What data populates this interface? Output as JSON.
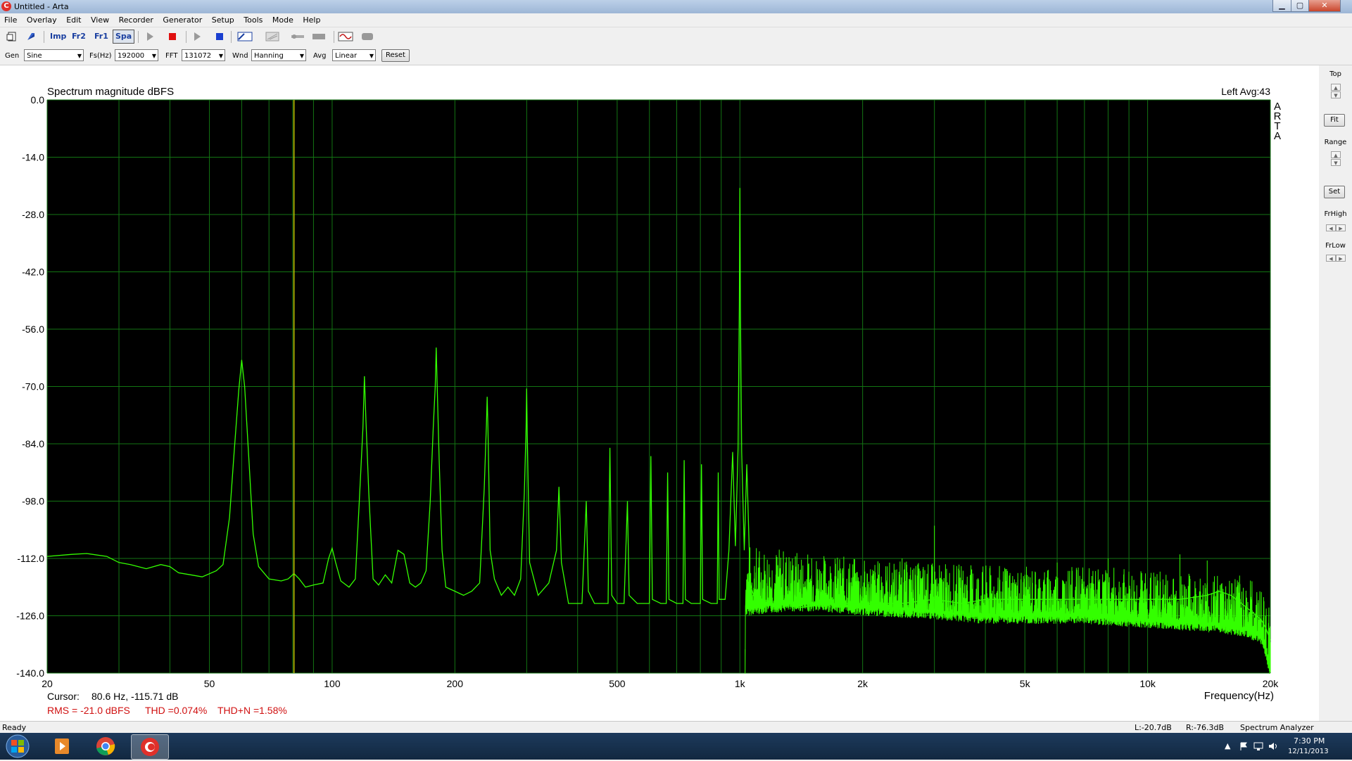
{
  "window": {
    "title": "Untitled - Arta",
    "minimize": "▁",
    "maximize": "▢",
    "close": "✕"
  },
  "menu": [
    "File",
    "Overlay",
    "Edit",
    "View",
    "Recorder",
    "Generator",
    "Setup",
    "Tools",
    "Mode",
    "Help"
  ],
  "toolbar": {
    "imp": "Imp",
    "fr2": "Fr2",
    "fr1": "Fr1",
    "spa": "Spa"
  },
  "options": {
    "gen_label": "Gen",
    "gen_value": "Sine",
    "fs_label": "Fs(Hz)",
    "fs_value": "192000",
    "fft_label": "FFT",
    "fft_value": "131072",
    "wnd_label": "Wnd",
    "wnd_value": "Hanning",
    "avg_label": "Avg",
    "avg_value": "Linear",
    "reset_label": "Reset"
  },
  "right_panel": {
    "top_label": "Top",
    "fit_label": "Fit",
    "range_label": "Range",
    "set_label": "Set",
    "frhigh_label": "FrHigh",
    "frlow_label": "FrLow"
  },
  "chart_data": {
    "type": "line",
    "title": "Spectrum magnitude dBFS",
    "channel_info": "Left  Avg:43",
    "brand": "ARTA",
    "xlabel": "Frequency(Hz)",
    "ylabel": "",
    "x_scale": "log",
    "xlim": [
      20,
      20000
    ],
    "ylim": [
      -140,
      0
    ],
    "x_ticks": [
      20,
      50,
      100,
      200,
      500,
      1000,
      2000,
      5000,
      10000,
      20000
    ],
    "x_tick_labels": [
      "20",
      "50",
      "100",
      "200",
      "500",
      "1k",
      "2k",
      "5k",
      "10k",
      "20k"
    ],
    "y_ticks": [
      0,
      -14,
      -28,
      -42,
      -56,
      -70,
      -84,
      -98,
      -112,
      -126,
      -140
    ],
    "y_tick_labels": [
      "0.0",
      "-14.0",
      "-28.0",
      "-42.0",
      "-56.0",
      "-70.0",
      "-84.0",
      "-98.0",
      "-112.0",
      "-126.0",
      "-140.0"
    ],
    "grid": true,
    "background": "#000000",
    "grid_color": "#137513",
    "line_color": "#33ff00",
    "cursor_color": "#c8c800",
    "cursor_x": 80.6,
    "series": [
      {
        "points": [
          [
            20,
            -111.5
          ],
          [
            23,
            -111
          ],
          [
            25,
            -110.8
          ],
          [
            28,
            -111.5
          ],
          [
            30,
            -113
          ],
          [
            32,
            -113.5
          ],
          [
            35,
            -114.5
          ],
          [
            38,
            -113.5
          ],
          [
            40,
            -114
          ],
          [
            42,
            -115.5
          ],
          [
            45,
            -116
          ],
          [
            48,
            -116.5
          ],
          [
            52,
            -115
          ],
          [
            54,
            -113.5
          ],
          [
            56,
            -102
          ],
          [
            57.5,
            -86
          ],
          [
            59,
            -71
          ],
          [
            60,
            -63.5
          ],
          [
            61,
            -70
          ],
          [
            62.5,
            -88
          ],
          [
            64,
            -106
          ],
          [
            66,
            -114
          ],
          [
            70,
            -117
          ],
          [
            75,
            -117.5
          ],
          [
            78,
            -117
          ],
          [
            80.6,
            -115.7
          ],
          [
            83,
            -117
          ],
          [
            86,
            -119
          ],
          [
            90,
            -118.5
          ],
          [
            95,
            -118
          ],
          [
            98,
            -112
          ],
          [
            100,
            -109.5
          ],
          [
            102,
            -113
          ],
          [
            105,
            -117.5
          ],
          [
            110,
            -119
          ],
          [
            114,
            -117
          ],
          [
            117,
            -95
          ],
          [
            119,
            -80
          ],
          [
            120,
            -67.5
          ],
          [
            121,
            -78
          ],
          [
            123,
            -96
          ],
          [
            126,
            -117
          ],
          [
            130,
            -118.5
          ],
          [
            135,
            -116
          ],
          [
            140,
            -118
          ],
          [
            145,
            -110
          ],
          [
            150,
            -111
          ],
          [
            155,
            -118
          ],
          [
            160,
            -119
          ],
          [
            165,
            -118
          ],
          [
            170,
            -115
          ],
          [
            174,
            -98
          ],
          [
            177,
            -80
          ],
          [
            179,
            -70
          ],
          [
            180,
            -60.5
          ],
          [
            181,
            -70
          ],
          [
            183,
            -88
          ],
          [
            186,
            -110
          ],
          [
            190,
            -119
          ],
          [
            200,
            -120
          ],
          [
            210,
            -121
          ],
          [
            220,
            -120
          ],
          [
            230,
            -118
          ],
          [
            236,
            -95
          ],
          [
            239,
            -79
          ],
          [
            240,
            -72.5
          ],
          [
            241,
            -80
          ],
          [
            244,
            -110
          ],
          [
            250,
            -117
          ],
          [
            260,
            -121
          ],
          [
            270,
            -119
          ],
          [
            280,
            -121
          ],
          [
            290,
            -117
          ],
          [
            296,
            -96
          ],
          [
            299,
            -80
          ],
          [
            300,
            -70.5
          ],
          [
            301,
            -82
          ],
          [
            305,
            -113
          ],
          [
            320,
            -121
          ],
          [
            340,
            -118
          ],
          [
            355,
            -110
          ],
          [
            360,
            -94.5
          ],
          [
            365,
            -113
          ],
          [
            380,
            -123
          ],
          [
            410,
            -123
          ],
          [
            420,
            -98
          ],
          [
            425,
            -120
          ],
          [
            440,
            -123
          ],
          [
            475,
            -123
          ],
          [
            480,
            -85
          ],
          [
            485,
            -121
          ],
          [
            500,
            -123
          ],
          [
            520,
            -123
          ],
          [
            530,
            -98
          ],
          [
            535,
            -121
          ],
          [
            560,
            -123
          ],
          [
            600,
            -123
          ],
          [
            605,
            -87
          ],
          [
            610,
            -122
          ],
          [
            640,
            -123
          ],
          [
            660,
            -123
          ],
          [
            665,
            -91
          ],
          [
            670,
            -122
          ],
          [
            700,
            -123
          ],
          [
            725,
            -123
          ],
          [
            730,
            -88
          ],
          [
            735,
            -122
          ],
          [
            760,
            -123
          ],
          [
            800,
            -123
          ],
          [
            805,
            -89
          ],
          [
            810,
            -122
          ],
          [
            850,
            -123
          ],
          [
            880,
            -123
          ],
          [
            885,
            -91
          ],
          [
            890,
            -122
          ],
          [
            920,
            -122
          ],
          [
            940,
            -110
          ],
          [
            960,
            -86
          ],
          [
            975,
            -109
          ],
          [
            990,
            -85
          ],
          [
            997,
            -50
          ],
          [
            1000,
            -21.5
          ],
          [
            1003,
            -50
          ],
          [
            1010,
            -86
          ],
          [
            1025,
            -110
          ],
          [
            1040,
            -89
          ],
          [
            1060,
            -118
          ],
          [
            1100,
            -124
          ],
          [
            1200,
            -123
          ],
          [
            1400,
            -124
          ],
          [
            1700,
            -123
          ],
          [
            2000,
            -123
          ],
          [
            2500,
            -123
          ],
          [
            3000,
            -122
          ],
          [
            3500,
            -123
          ],
          [
            4000,
            -122
          ],
          [
            5000,
            -122
          ],
          [
            6000,
            -122
          ],
          [
            8000,
            -122
          ],
          [
            10000,
            -122
          ],
          [
            12000,
            -122
          ],
          [
            14000,
            -121
          ],
          [
            15000,
            -120
          ],
          [
            16000,
            -121
          ],
          [
            17000,
            -123
          ],
          [
            18000,
            -125
          ],
          [
            19000,
            -127
          ],
          [
            19500,
            -129
          ],
          [
            20000,
            -132
          ]
        ],
        "noise_floor": [
          [
            1030,
            -124
          ],
          [
            1300,
            -123
          ],
          [
            1600,
            -123
          ],
          [
            2000,
            -124
          ],
          [
            3000,
            -125
          ],
          [
            4000,
            -126
          ],
          [
            5000,
            -126
          ],
          [
            7000,
            -126
          ],
          [
            10000,
            -127
          ],
          [
            14000,
            -128
          ],
          [
            17000,
            -129
          ],
          [
            19000,
            -131
          ],
          [
            20000,
            -139
          ]
        ],
        "noise_ceiling": [
          [
            1030,
            -108
          ],
          [
            1400,
            -110
          ],
          [
            2000,
            -112
          ],
          [
            3000,
            -113
          ],
          [
            5000,
            -114
          ],
          [
            7000,
            -114
          ],
          [
            10000,
            -114.5
          ],
          [
            14000,
            -116
          ],
          [
            16000,
            -115
          ],
          [
            18000,
            -117
          ],
          [
            19500,
            -120
          ],
          [
            20000,
            -124
          ]
        ],
        "isolated_spikes": [
          [
            1500,
            -112
          ],
          [
            2500,
            -112
          ],
          [
            3000,
            -104
          ],
          [
            5000,
            -116
          ],
          [
            6000,
            -113
          ],
          [
            8000,
            -112
          ],
          [
            12000,
            -111
          ],
          [
            14000,
            -112.5
          ]
        ]
      }
    ]
  },
  "readouts": {
    "cursor_label": "Cursor:",
    "cursor_value": "80.6 Hz, -115.71 dB",
    "rms": "RMS =  -21.0 dBFS",
    "thd": "THD =0.074%",
    "thdn": "THD+N =1.58%"
  },
  "status": {
    "ready": "Ready",
    "left_level": "L:-20.7dB",
    "right_level": "R:-76.3dB",
    "mode": "Spectrum Analyzer"
  },
  "tray": {
    "time": "7:30 PM",
    "date": "12/11/2013"
  }
}
